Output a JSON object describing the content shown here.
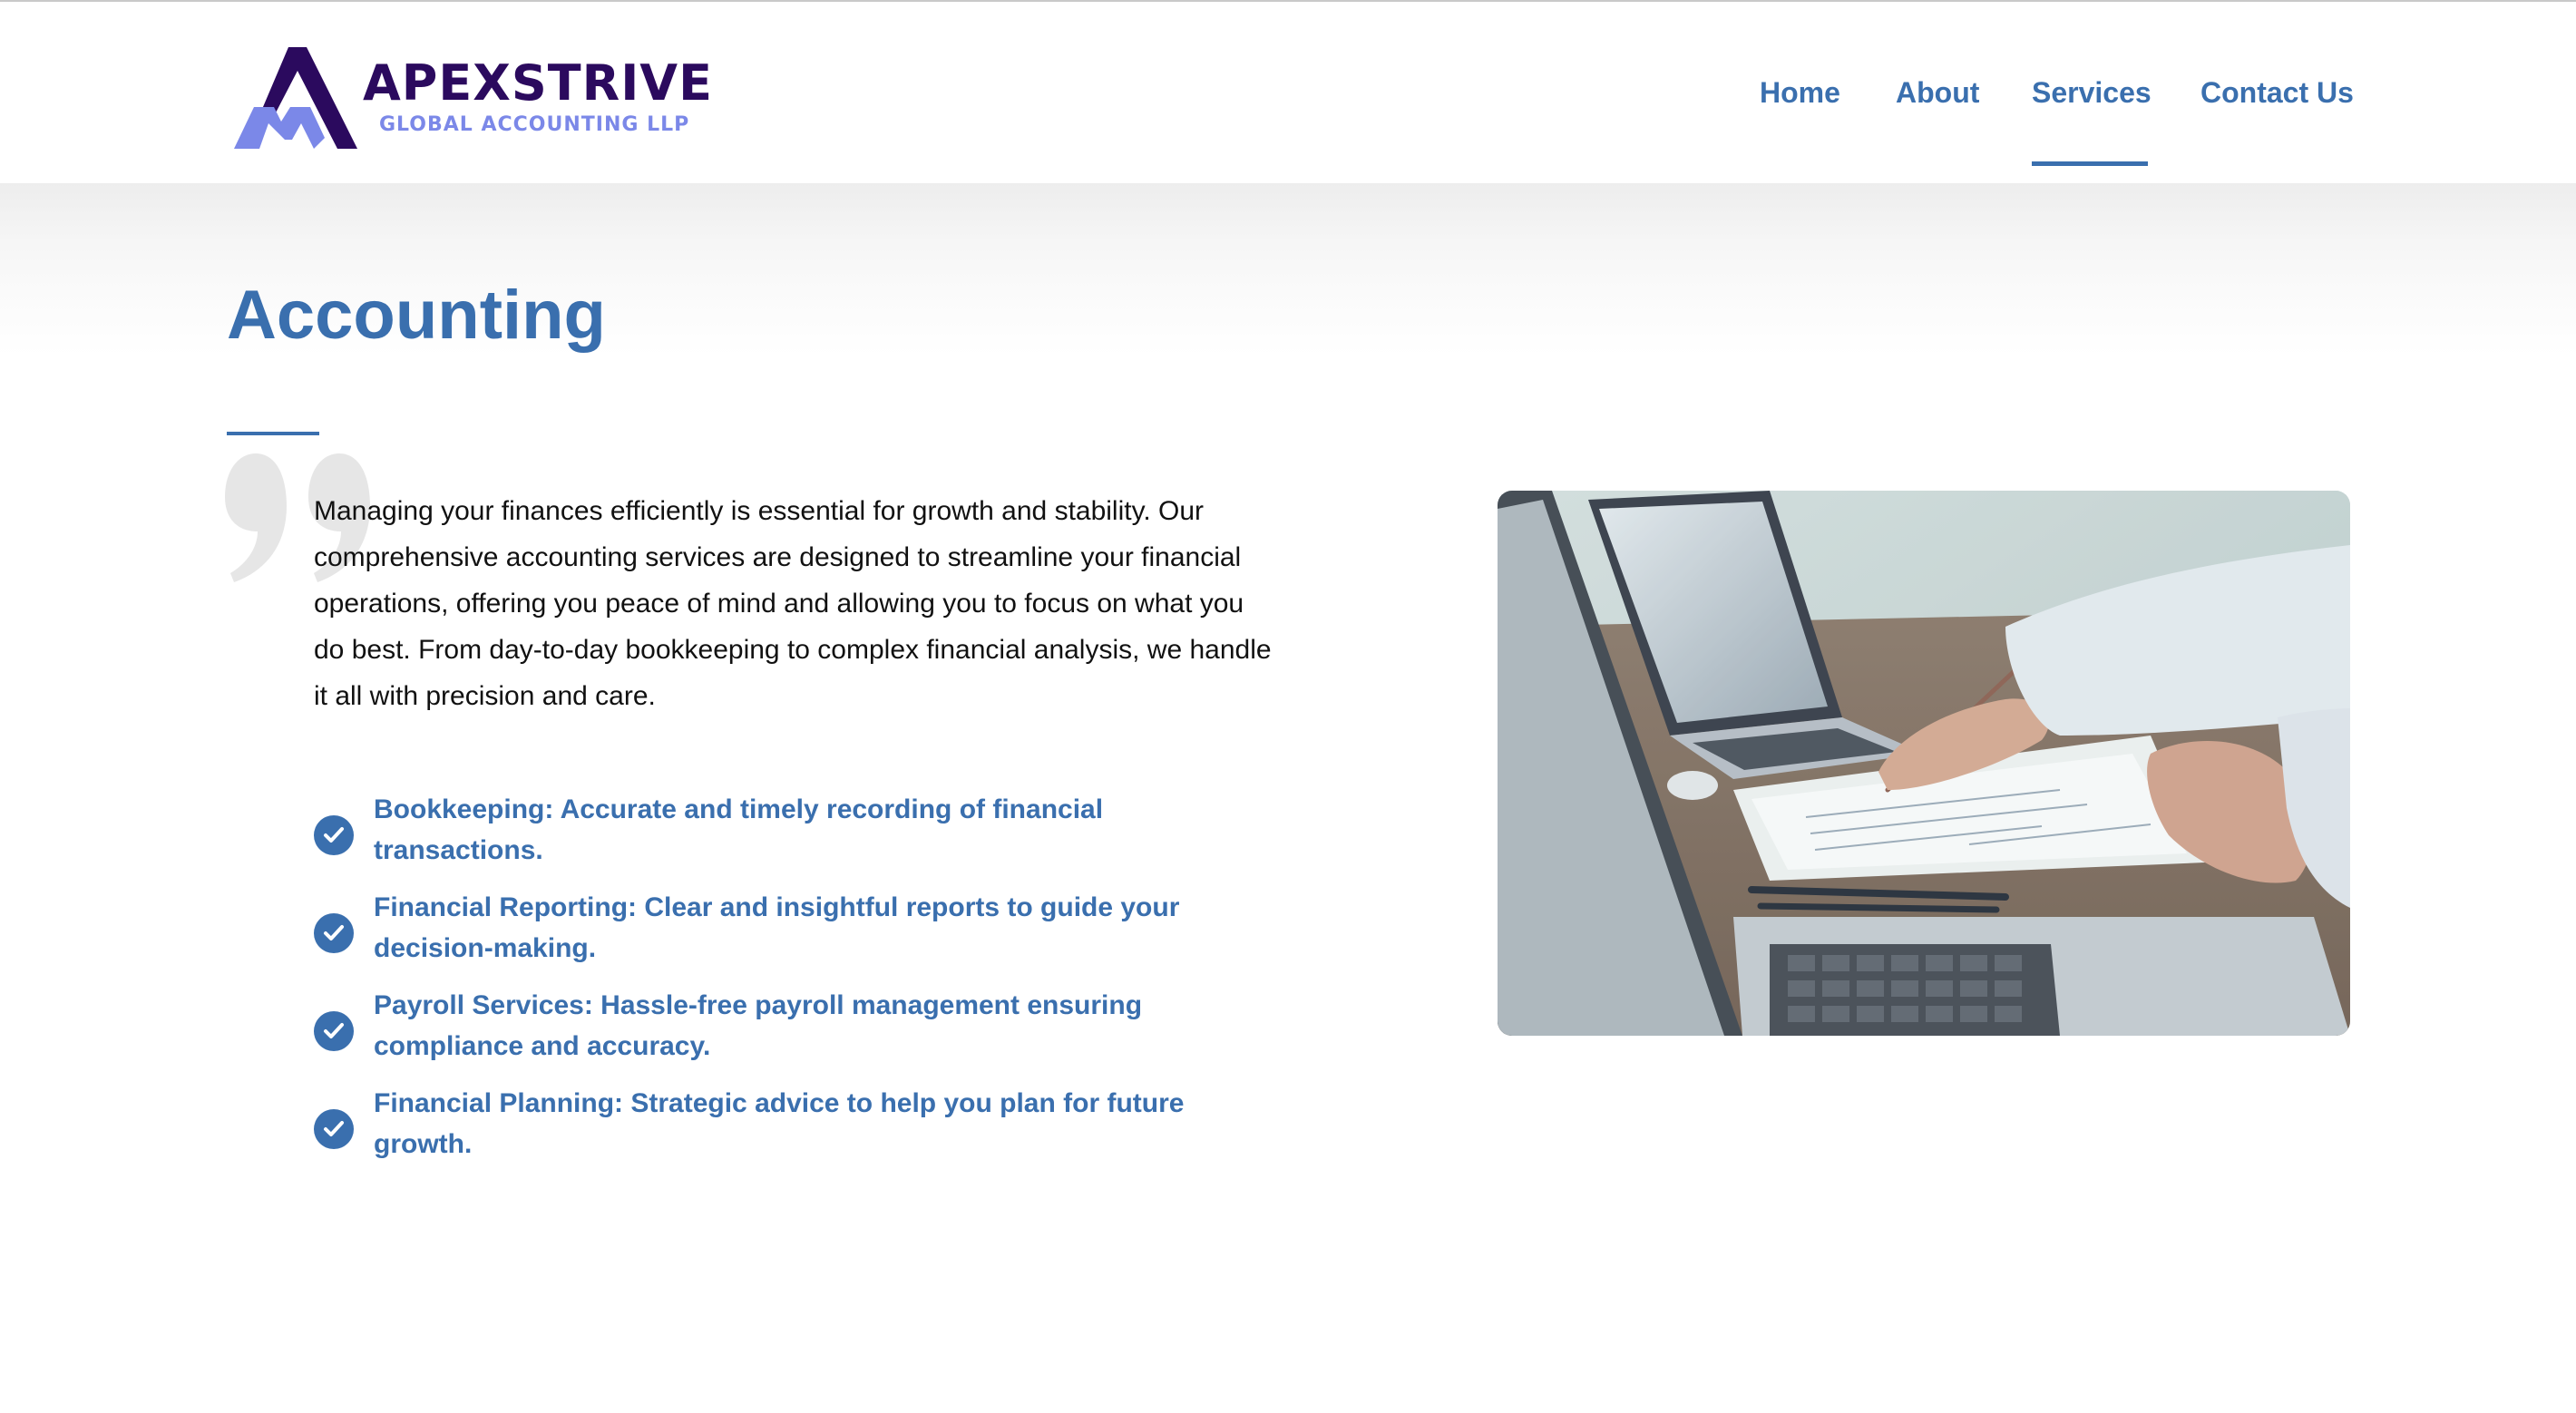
{
  "header": {
    "logo": {
      "name": "APEXSTRIVE",
      "subtitle": "GLOBAL ACCOUNTING LLP"
    },
    "nav": [
      {
        "label": "Home",
        "active": false
      },
      {
        "label": "About",
        "active": false
      },
      {
        "label": "Services",
        "active": true
      },
      {
        "label": "Contact Us",
        "active": false
      }
    ]
  },
  "main": {
    "title": "Accounting",
    "intro": "Managing your finances efficiently is essential for growth and stability. Our comprehensive accounting services are designed to streamline your financial operations, offering you peace of mind and allowing you to focus on what you do best. From day-to-day bookkeeping to complex financial analysis, we handle it all with precision and care.",
    "features": [
      {
        "text": "Bookkeeping: Accurate and timely recording of financial transactions.",
        "icon": "check-circle-icon"
      },
      {
        "text": "Financial Reporting: Clear and insightful reports to guide your decision-making.",
        "icon": "check-circle-icon"
      },
      {
        "text": "Payroll Services: Hassle-free payroll management ensuring compliance and accuracy.",
        "icon": "check-circle-icon"
      },
      {
        "text": "Financial Planning: Strategic advice to help you plan for future growth.",
        "icon": "check-circle-icon"
      }
    ]
  },
  "colors": {
    "accent": "#3a6fae",
    "logo_dark": "#2b0a5e",
    "logo_light": "#7b88e8",
    "body_text": "#111111"
  }
}
